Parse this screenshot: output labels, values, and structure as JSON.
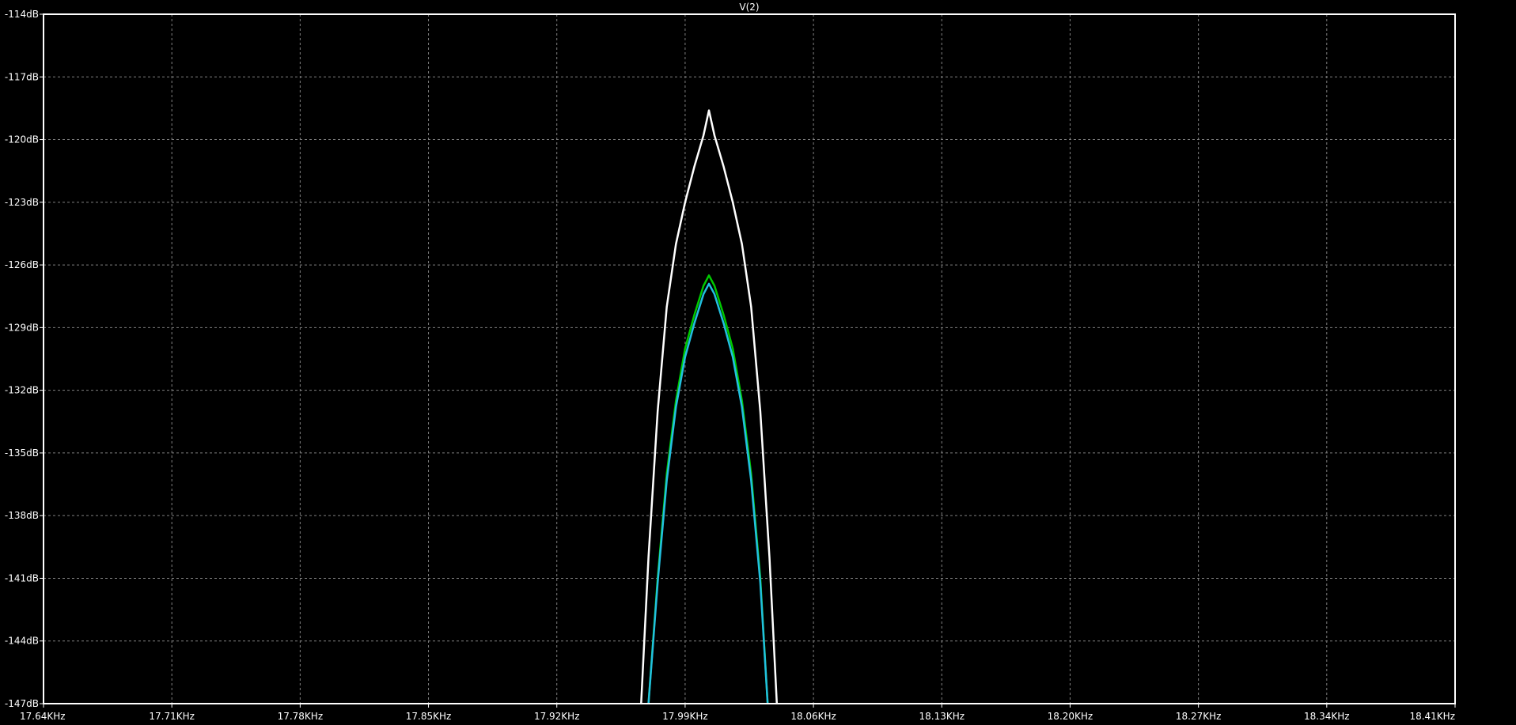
{
  "chart_data": {
    "type": "line",
    "title": "V(2)",
    "xlabel": "",
    "ylabel": "",
    "xlim": [
      17.64,
      18.41
    ],
    "ylim": [
      -147,
      -114
    ],
    "x_ticks": [
      17.64,
      17.71,
      17.78,
      17.85,
      17.92,
      17.99,
      18.06,
      18.13,
      18.2,
      18.27,
      18.34,
      18.41
    ],
    "x_tick_labels": [
      "17.64KHz",
      "17.71KHz",
      "17.78KHz",
      "17.85KHz",
      "17.92KHz",
      "17.99KHz",
      "18.06KHz",
      "18.13KHz",
      "18.20KHz",
      "18.27KHz",
      "18.34KHz",
      "18.41KHz"
    ],
    "y_ticks": [
      -114,
      -117,
      -120,
      -123,
      -126,
      -129,
      -132,
      -135,
      -138,
      -141,
      -144,
      -147
    ],
    "y_tick_labels": [
      "-114dB",
      "-117dB",
      "-120dB",
      "-123dB",
      "-126dB",
      "-129dB",
      "-132dB",
      "-135dB",
      "-138dB",
      "-141dB",
      "-144dB",
      "-147dB"
    ],
    "grid": true,
    "background": "#000000",
    "frame_color": "#ffffff",
    "grid_color": "#808080",
    "series": [
      {
        "color": "#ffffff",
        "points": [
          [
            17.966,
            -147.0
          ],
          [
            17.97,
            -140.0
          ],
          [
            17.975,
            -133.0
          ],
          [
            17.98,
            -128.0
          ],
          [
            17.985,
            -125.0
          ],
          [
            17.99,
            -123.0
          ],
          [
            17.995,
            -121.3
          ],
          [
            18.0,
            -119.8
          ],
          [
            18.003,
            -118.6
          ],
          [
            18.006,
            -119.8
          ],
          [
            18.011,
            -121.3
          ],
          [
            18.016,
            -123.0
          ],
          [
            18.021,
            -125.0
          ],
          [
            18.026,
            -128.0
          ],
          [
            18.031,
            -133.0
          ],
          [
            18.036,
            -140.0
          ],
          [
            18.04,
            -147.0
          ]
        ]
      },
      {
        "color": "#00c800",
        "points": [
          [
            17.97,
            -147.0
          ],
          [
            17.975,
            -141.0
          ],
          [
            17.98,
            -136.0
          ],
          [
            17.985,
            -132.5
          ],
          [
            17.99,
            -130.0
          ],
          [
            17.995,
            -128.4
          ],
          [
            18.0,
            -127.0
          ],
          [
            18.003,
            -126.5
          ],
          [
            18.006,
            -127.0
          ],
          [
            18.011,
            -128.4
          ],
          [
            18.016,
            -130.0
          ],
          [
            18.021,
            -132.5
          ],
          [
            18.026,
            -136.0
          ],
          [
            18.031,
            -141.0
          ],
          [
            18.035,
            -147.0
          ]
        ]
      },
      {
        "color": "#22c0e0",
        "points": [
          [
            17.97,
            -147.0
          ],
          [
            17.975,
            -141.2
          ],
          [
            17.98,
            -136.3
          ],
          [
            17.985,
            -132.8
          ],
          [
            17.99,
            -130.4
          ],
          [
            17.995,
            -128.8
          ],
          [
            18.0,
            -127.4
          ],
          [
            18.003,
            -126.9
          ],
          [
            18.006,
            -127.4
          ],
          [
            18.011,
            -128.8
          ],
          [
            18.016,
            -130.4
          ],
          [
            18.021,
            -132.8
          ],
          [
            18.026,
            -136.3
          ],
          [
            18.031,
            -141.2
          ],
          [
            18.035,
            -147.0
          ]
        ]
      }
    ]
  }
}
